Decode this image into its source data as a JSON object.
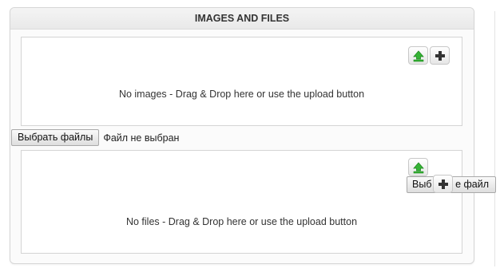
{
  "panel": {
    "title": "IMAGES AND FILES"
  },
  "images": {
    "empty_message": "No images - Drag & Drop here or use the upload button",
    "file_input": {
      "button_label": "Выбрать файлы",
      "status": "Файл не выбран"
    }
  },
  "files": {
    "empty_message": "No files - Drag & Drop here or use the upload button",
    "file_input": {
      "button_label_left": "Выб",
      "button_label_right": "е файл"
    }
  },
  "icons": {
    "upload": "upload-icon",
    "add": "plus-icon"
  },
  "colors": {
    "upload_green": "#35b335",
    "plus_dark": "#333333"
  }
}
